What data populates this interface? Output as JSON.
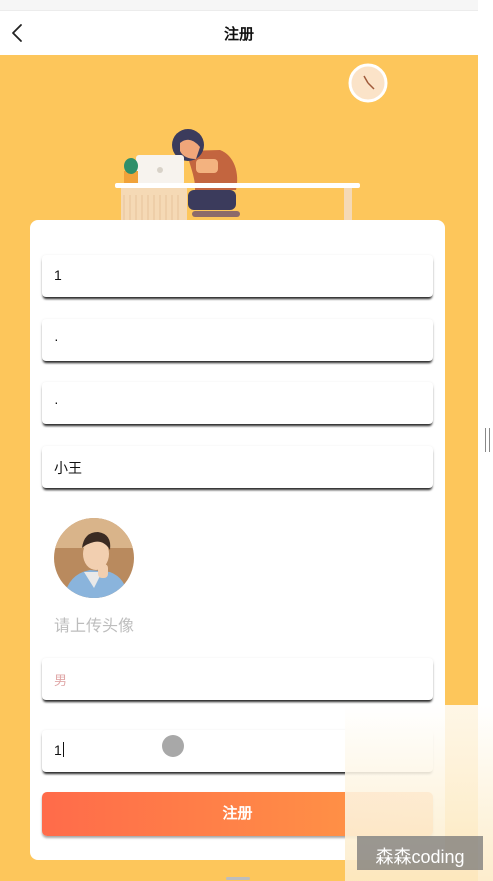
{
  "nav": {
    "title": "注册"
  },
  "form": {
    "username_value": "1",
    "password_value": "·",
    "confirm_password_value": "·",
    "nickname_value": "小王",
    "avatar_prompt": "请上传头像",
    "gender_placeholder": "男",
    "last_field_value": "1",
    "submit_label": "注册"
  },
  "watermark": {
    "text": "森森coding"
  },
  "colors": {
    "hero_bg": "#fdc65b",
    "submit_gradient_start": "#ff6b4a",
    "submit_gradient_end": "#ff9a45",
    "placeholder": "#e0a8a8"
  },
  "icons": [
    "back-icon",
    "clock-icon",
    "laptop-icon",
    "plant-icon"
  ]
}
